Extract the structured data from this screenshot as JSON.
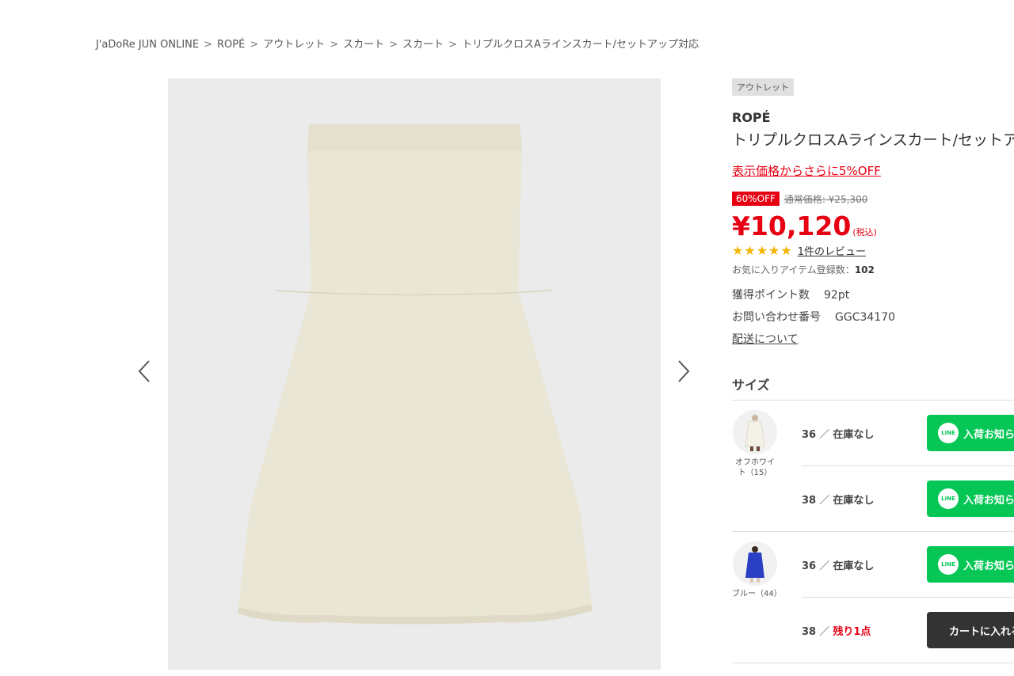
{
  "breadcrumb": [
    "J'aDoRe JUN ONLINE",
    "ROPÉ",
    "アウトレット",
    "スカート",
    "スカート",
    "トリプルクロスAラインスカート/セットアップ対応"
  ],
  "breadcrumb_sep": ">",
  "gallery": {
    "prev_icon": "chevron-left-icon",
    "next_icon": "chevron-right-icon"
  },
  "product": {
    "tag": "アウトレット",
    "brand": "ROPÉ",
    "title": "トリプルクロスAラインスカート/セットアップ対応",
    "promo": "表示価格からさらに5%OFF",
    "off_badge": "60%OFF",
    "regular_price": "通常価格: ¥25,300",
    "price": "¥10,120",
    "tax": "(税込)",
    "stars": "★★★★★",
    "rating": 5,
    "review_link": "1件のレビュー",
    "favorite_label": "お気に入りアイテム登録数：",
    "favorite_count": "102",
    "points_label": "獲得ポイント数",
    "points_value": "92pt",
    "inquiry_label": "お問い合わせ番号",
    "inquiry_value": "GGC34170",
    "shipping_link": "配送について"
  },
  "size_section": {
    "heading": "サイズ",
    "colors": [
      {
        "name": "オフホワイト（15）",
        "rows": [
          {
            "size": "36",
            "slash": "／",
            "status": "在庫なし",
            "button": "入荷お知らせ",
            "button_icon": "LINE"
          },
          {
            "size": "38",
            "slash": "／",
            "status": "在庫なし",
            "button": "入荷お知らせ",
            "button_icon": "LINE"
          }
        ]
      },
      {
        "name": "ブルー（44）",
        "rows": [
          {
            "size": "36",
            "slash": "／",
            "status": "在庫なし",
            "button": "入荷お知らせ",
            "button_icon": "LINE"
          },
          {
            "size": "38",
            "slash": "／",
            "status": "残り1点",
            "button": "カートに入れる"
          }
        ]
      }
    ]
  },
  "colors": {
    "accent": "#e60012",
    "line_green": "#06c755",
    "cart_dark": "#333333",
    "star": "#f5b400"
  }
}
